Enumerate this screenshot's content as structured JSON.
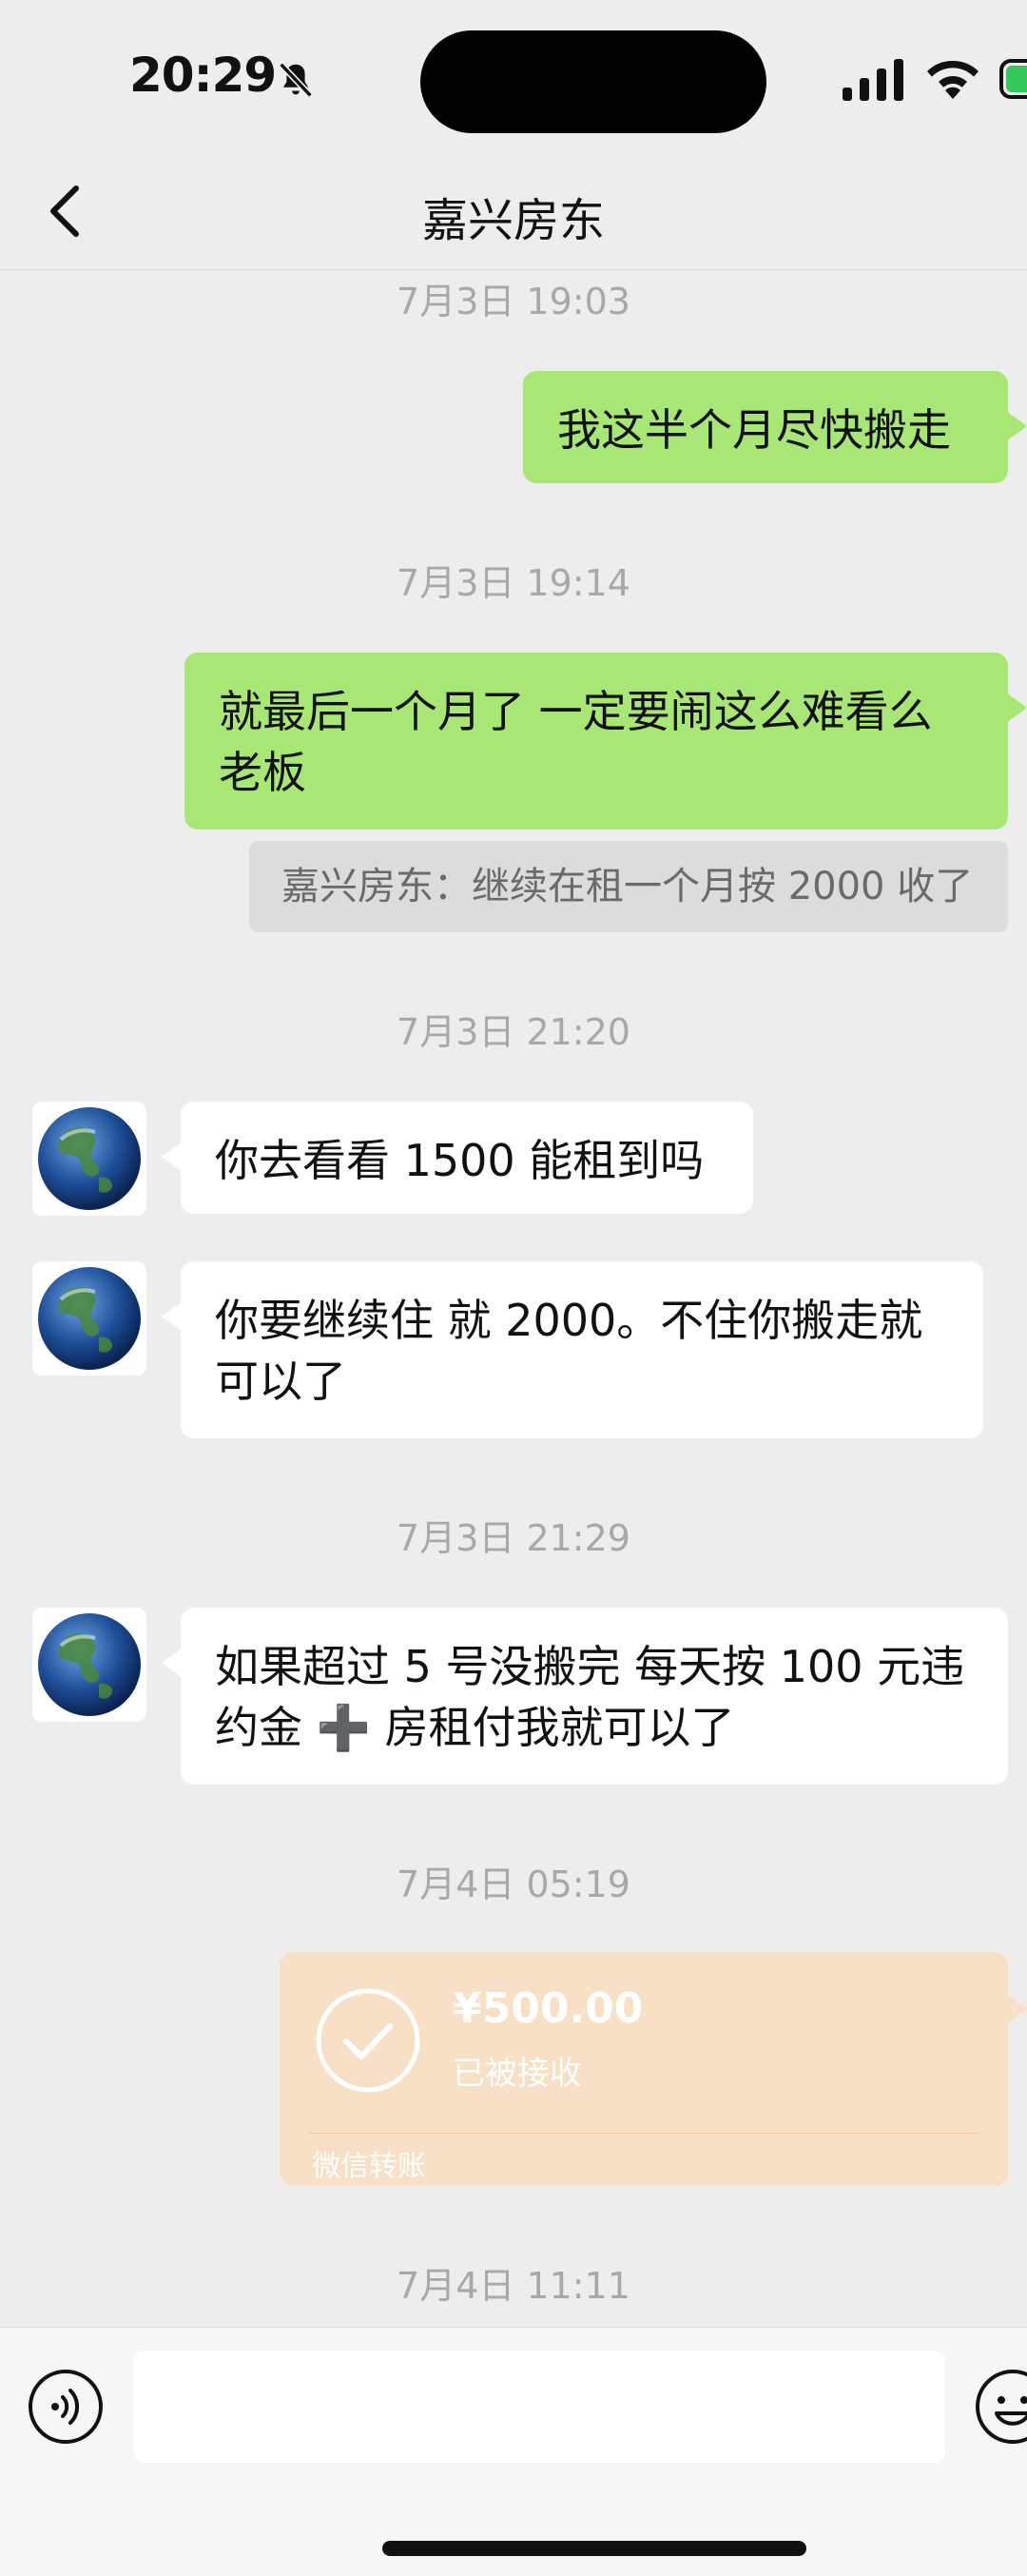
{
  "status": {
    "time": "20:29"
  },
  "header": {
    "title": "嘉兴房东"
  },
  "messages": {
    "ts1": "7月3日 19:03",
    "m1": "我这半个月尽快搬走",
    "ts2": "7月3日 19:14",
    "m2": "就最后一个月了 一定要闹这么难看么老板",
    "quote": "嘉兴房东：继续在租一个月按 2000 收了",
    "ts3": "7月3日 21:20",
    "m3": "你去看看 1500 能租到吗",
    "m4": "你要继续住 就 2000。不住你搬走就可以了",
    "ts4": "7月3日 21:29",
    "m5": "如果超过 5 号没搬完  每天按 100 元违约金 ➕ 房租付我就可以了",
    "ts5": "7月4日 05:19",
    "ts6": "7月4日 11:11"
  },
  "transfer": {
    "amount": "¥500.00",
    "status": "已被接收",
    "label": "微信转账"
  },
  "input": {
    "placeholder": ""
  },
  "icons": [
    "bell-slash-icon",
    "signal-icon",
    "wifi-icon",
    "battery-icon",
    "back-chevron-icon",
    "globe-avatar-icon",
    "check-circle-icon",
    "voice-icon",
    "emoji-icon"
  ]
}
